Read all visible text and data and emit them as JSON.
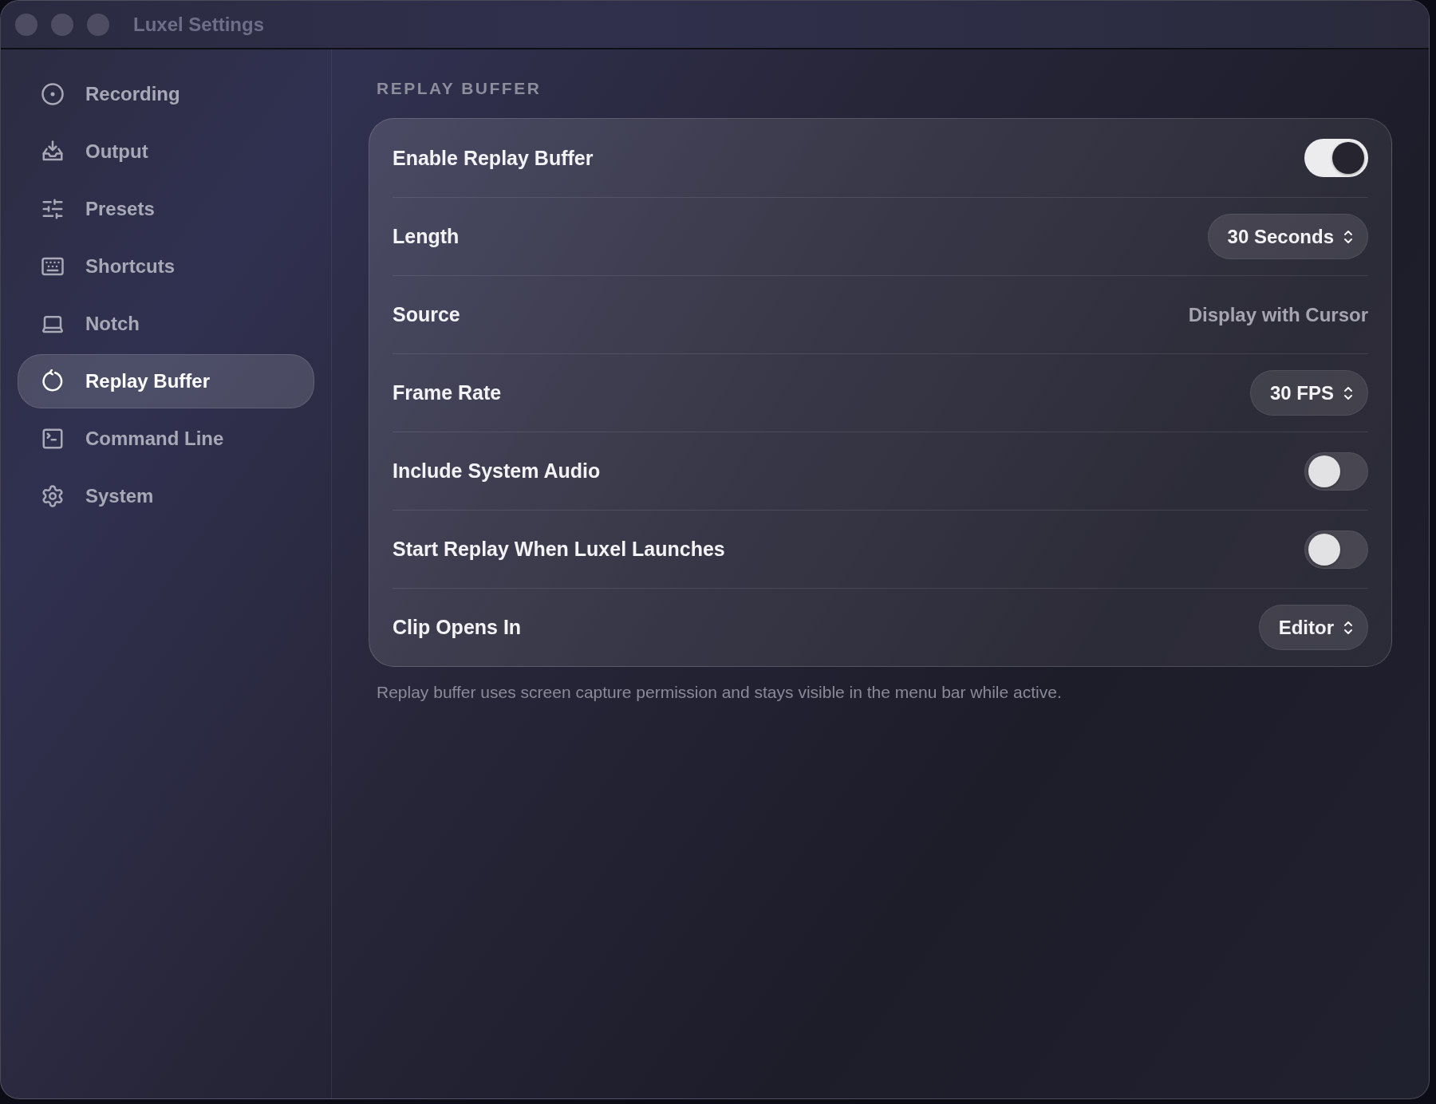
{
  "window": {
    "title": "Luxel Settings"
  },
  "sidebar": {
    "items": [
      {
        "label": "Recording",
        "selected": false
      },
      {
        "label": "Output",
        "selected": false
      },
      {
        "label": "Presets",
        "selected": false
      },
      {
        "label": "Shortcuts",
        "selected": false
      },
      {
        "label": "Notch",
        "selected": false
      },
      {
        "label": "Replay Buffer",
        "selected": true
      },
      {
        "label": "Command Line",
        "selected": false
      },
      {
        "label": "System",
        "selected": false
      }
    ]
  },
  "section": {
    "title": "REPLAY BUFFER",
    "rows": [
      {
        "kind": "toggle",
        "label": "Enable Replay Buffer",
        "on": true
      },
      {
        "kind": "select",
        "label": "Length",
        "value": "30 Seconds"
      },
      {
        "kind": "text",
        "label": "Source",
        "value": "Display with Cursor"
      },
      {
        "kind": "select",
        "label": "Frame Rate",
        "value": "30 FPS"
      },
      {
        "kind": "toggle",
        "label": "Include System Audio",
        "on": false
      },
      {
        "kind": "toggle",
        "label": "Start Replay When Luxel Launches",
        "on": false
      },
      {
        "kind": "select",
        "label": "Clip Opens In",
        "value": "Editor"
      }
    ],
    "footnote": "Replay buffer uses screen capture permission and stays visible in the menu bar while active."
  }
}
